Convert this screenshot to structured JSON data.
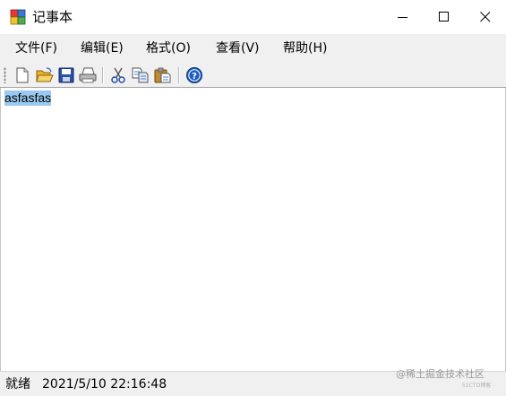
{
  "window": {
    "title": "记事本"
  },
  "menu": {
    "items": [
      {
        "label": "文件(F)"
      },
      {
        "label": "编辑(E)"
      },
      {
        "label": "格式(O)"
      },
      {
        "label": "查看(V)"
      },
      {
        "label": "帮助(H)"
      }
    ]
  },
  "toolbar": {
    "icons": [
      "new-file-icon",
      "open-folder-icon",
      "save-disk-icon",
      "print-icon",
      "cut-icon",
      "copy-icon",
      "paste-icon",
      "help-icon"
    ]
  },
  "editor": {
    "content": "asfasfas",
    "selection_color": "#99c9ef"
  },
  "status": {
    "state": "就绪",
    "datetime": "2021/5/10 22:16:48"
  },
  "watermark": {
    "text": "@稀土掘金技术社区",
    "subtext": "51CTO博客"
  },
  "colors": {
    "chrome": "#f0f0f0",
    "background": "#ffffff",
    "help_blue": "#1c5fbf"
  }
}
